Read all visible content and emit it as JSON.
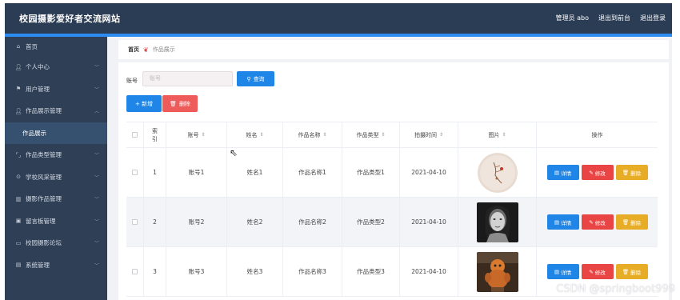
{
  "app": {
    "title": "校园摄影爱好者交流网站",
    "admin_label": "管理员 abo",
    "back_to_front": "退出到前台",
    "logout": "退出登录"
  },
  "colors": {
    "topbar": "#2b3d55",
    "sidebar": "#2f3f55",
    "primary": "#1f86e8",
    "danger": "#ea4545",
    "warning": "#e8ad27"
  },
  "sidebar": {
    "items": [
      {
        "label": "首页",
        "icon": "home-icon"
      },
      {
        "label": "个人中心",
        "icon": "user-icon"
      },
      {
        "label": "用户管理",
        "icon": "flag-icon"
      },
      {
        "label": "作品展示管理",
        "icon": "user-icon"
      },
      {
        "label": "作品展示",
        "icon": ""
      },
      {
        "label": "作品类型管理",
        "icon": "bracket-icon"
      },
      {
        "label": "学校风采管理",
        "icon": "compass-icon"
      },
      {
        "label": "摄影作品管理",
        "icon": "bank-icon"
      },
      {
        "label": "留言板管理",
        "icon": "message-icon"
      },
      {
        "label": "校园摄影论坛",
        "icon": "monitor-icon"
      },
      {
        "label": "系统管理",
        "icon": "chart-icon"
      }
    ]
  },
  "breadcrumb": {
    "home": "首页",
    "current": "作品展示"
  },
  "search": {
    "label": "账号",
    "placeholder": "账号",
    "button": "查询"
  },
  "toolbar": {
    "add": "+ 新增",
    "delete": "删除"
  },
  "table": {
    "headers": {
      "index": "索引",
      "account": "账号",
      "name": "姓名",
      "work_name": "作品名称",
      "work_type": "作品类型",
      "shot_time": "拍摄时间",
      "image": "图片",
      "ops": "操作"
    },
    "rows": [
      {
        "index": "1",
        "account": "账号1",
        "name": "姓名1",
        "work_name": "作品名称1",
        "work_type": "作品类型1",
        "shot_time": "2021-04-10",
        "image": "sketch-photo"
      },
      {
        "index": "2",
        "account": "账号2",
        "name": "姓名2",
        "work_name": "作品名称2",
        "work_type": "作品类型2",
        "shot_time": "2021-04-10",
        "image": "portrait-photo"
      },
      {
        "index": "3",
        "account": "账号3",
        "name": "姓名3",
        "work_name": "作品名称3",
        "work_type": "作品类型3",
        "shot_time": "2021-04-10",
        "image": "toy-photo"
      }
    ],
    "op_labels": {
      "detail": "详情",
      "edit": "修改",
      "remove": "删除"
    }
  },
  "watermark": "CSDN @springboot999"
}
